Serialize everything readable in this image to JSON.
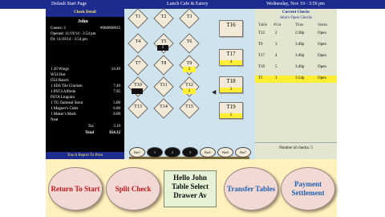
{
  "topbar": {
    "left": "Default Start Page",
    "center": "Lunch Cafe & Eatery",
    "right": "Wednesday, Nov 19 - 3:56 pm"
  },
  "check": {
    "title": "Check Detail",
    "server": "John",
    "guests": "Guests: 3",
    "check_no": "#000000035",
    "opened": "Opened: 11/19/14 - 3:54 pm",
    "dt": "Dt: 11/19/14 - 3:54 pm",
    "items": [
      {
        "name": "1  20 Wings",
        "price": "14.49"
      },
      {
        "name": "   W54 Hot",
        "price": ""
      },
      {
        "name": "   D54 Ranch",
        "price": ""
      },
      {
        "name": "1  SD4 Tile Chicken",
        "price": "7.49"
      },
      {
        "name": "1  PST4 Alfredo",
        "price": "7.95"
      },
      {
        "name": "   PSTA Linguini",
        "price": ""
      },
      {
        "name": "1  TG Oatmeal Stout",
        "price": "5.00"
      },
      {
        "name": "1  Magner's Cider",
        "price": "6.00"
      },
      {
        "name": "1  Maker's Mark",
        "price": "8.00"
      },
      {
        "name": "   Neat",
        "price": ""
      }
    ],
    "tax_label": "Tax",
    "tax": "3.19",
    "total_label": "Total",
    "total": "$54.12",
    "footer": "Touch Report To Print"
  },
  "floor": {
    "tables": [
      {
        "label": "T1",
        "badge": "",
        "badge_style": ""
      },
      {
        "label": "T2",
        "badge": "",
        "badge_style": ""
      },
      {
        "label": "T3",
        "badge": "",
        "badge_style": ""
      },
      {
        "label": "T4",
        "badge": "",
        "badge_style": ""
      },
      {
        "label": "T5",
        "badge": "2",
        "badge_style": "dark"
      },
      {
        "label": "T6",
        "badge": "",
        "badge_style": ""
      },
      {
        "label": "T7",
        "badge": "",
        "badge_style": ""
      },
      {
        "label": "T8",
        "badge": "",
        "badge_style": ""
      },
      {
        "label": "T9",
        "badge": "3",
        "badge_style": "yellow"
      },
      {
        "label": "T10",
        "badge": "",
        "badge_style": "dark"
      },
      {
        "label": "T11",
        "badge": "",
        "badge_style": ""
      },
      {
        "label": "T12",
        "badge": "2",
        "badge_style": "yellow"
      },
      {
        "label": "T13",
        "badge": "",
        "badge_style": ""
      },
      {
        "label": "T14",
        "badge": "",
        "badge_style": ""
      },
      {
        "label": "T15",
        "badge": "",
        "badge_style": ""
      }
    ],
    "square_tables": [
      {
        "label": "T16",
        "badge": ""
      },
      {
        "label": "T17",
        "badge": "4"
      },
      {
        "label": "T18",
        "badge": "3"
      },
      {
        "label": "T19",
        "badge": "5"
      }
    ],
    "bar_seats": [
      "Bar1",
      "1",
      "2",
      "3",
      "Bar5",
      "Bar6",
      "Bar7"
    ]
  },
  "open_checks": {
    "title": "Current Checks",
    "subtitle": "John's Open Checks",
    "columns": [
      "Table",
      "#Gst",
      "Time",
      "Status"
    ],
    "rows": [
      {
        "table": "T12",
        "guests": "2",
        "time": "2:38p",
        "status": "Open",
        "selected": false
      },
      {
        "table": "T9",
        "guests": "3",
        "time": "3:46p",
        "status": "Open",
        "selected": false
      },
      {
        "table": "T17",
        "guests": "4",
        "time": "3:46p",
        "status": "Open",
        "selected": false
      },
      {
        "table": "T19",
        "guests": "5",
        "time": "3:46p",
        "status": "Open",
        "selected": false
      },
      {
        "table": "T5",
        "guests": "3",
        "time": "3:54p",
        "status": "Open",
        "selected": true
      }
    ],
    "count_label": "Number of checks: 5"
  },
  "buttons": {
    "return": "Return To Start",
    "split": "Split Check",
    "hello": "Hello John",
    "table_select": "Table Select",
    "drawer": "Drawer Av",
    "transfer": "Transfer Tables",
    "payment": "Payment Settlement"
  },
  "colors": {
    "topbar": "#1d2a8e",
    "accent_yellow": "#ffee33",
    "button_red": "#c4141c",
    "button_blue": "#1e5fb3"
  }
}
